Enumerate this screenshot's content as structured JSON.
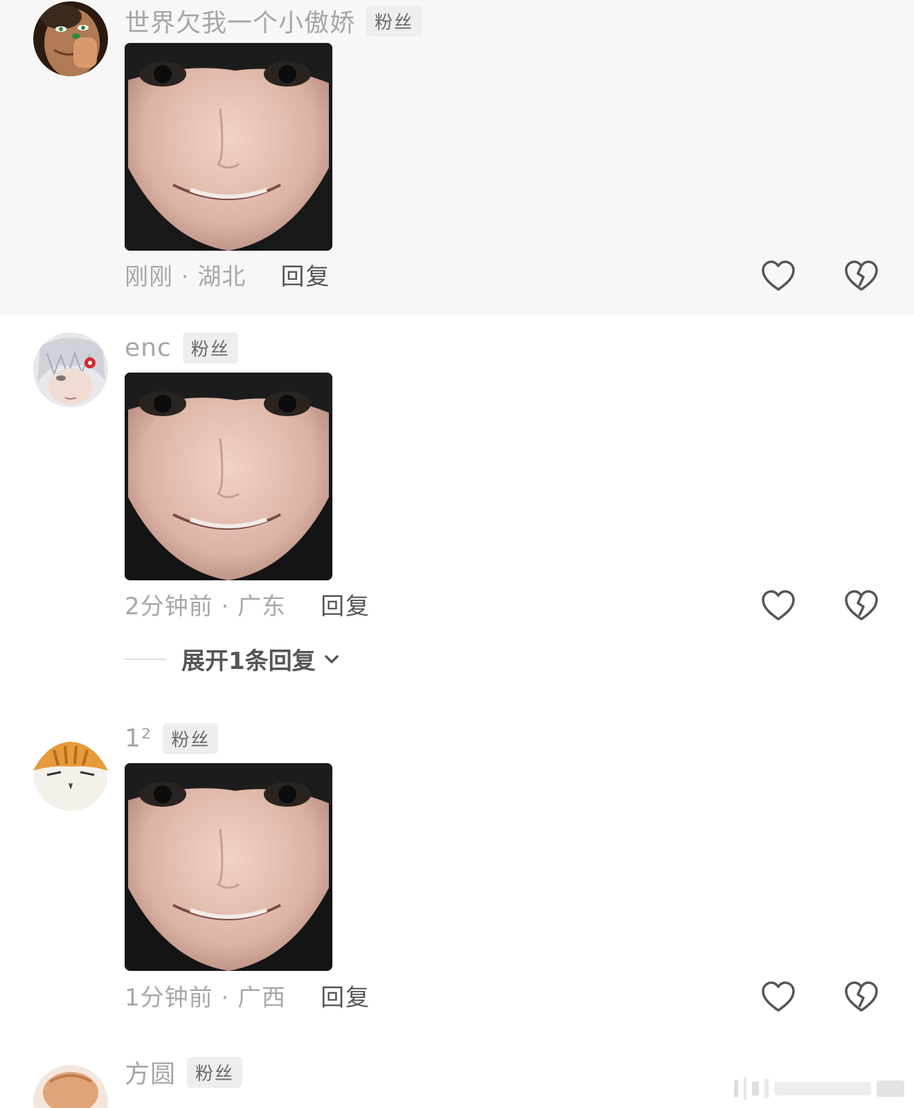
{
  "fan_badge_label": "粉丝",
  "reply_label": "回复",
  "comments": [
    {
      "username": "世界欠我一个小傲娇",
      "time_location": "刚刚 · 湖北"
    },
    {
      "username": "enc",
      "time_location": "2分钟前 · 广东",
      "expand_label": "展开1条回复"
    },
    {
      "username": "1²",
      "time_location": "1分钟前 · 广西"
    },
    {
      "username": "方圆"
    }
  ],
  "colors": {
    "highlight_background": "#f7f7f7",
    "muted_text": "#a6a6a6",
    "badge_background": "#eeeeee",
    "reply_text": "#555555"
  },
  "icons": [
    "like-icon",
    "dislike-icon",
    "chevron-down-icon"
  ]
}
